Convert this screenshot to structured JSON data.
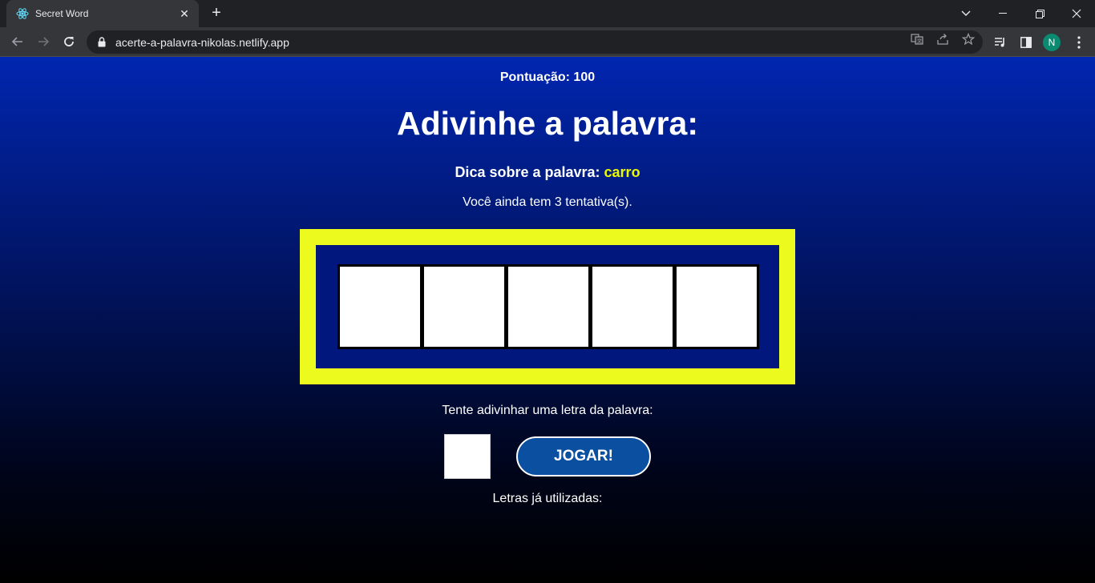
{
  "browser": {
    "tab_title": "Secret Word",
    "url": "acerte-a-palavra-nikolas.netlify.app",
    "profile_initial": "N"
  },
  "game": {
    "score_text": "Pontuação: 100",
    "title": "Adivinhe a palavra:",
    "tip_label": "Dica sobre a palavra: ",
    "tip_word": "carro",
    "attempts_text": "Você ainda tem 3 tentativa(s).",
    "letters": [
      "",
      "",
      "",
      "",
      ""
    ],
    "guess_label": "Tente adivinhar uma letra da palavra:",
    "guess_value": "",
    "play_label": "JOGAR!",
    "used_letters_label": "Letras já utilizadas:"
  },
  "colors": {
    "accent_yellow": "#ecfa1e",
    "button_blue": "#0a4fa0",
    "frame_blue": "#01177d"
  }
}
